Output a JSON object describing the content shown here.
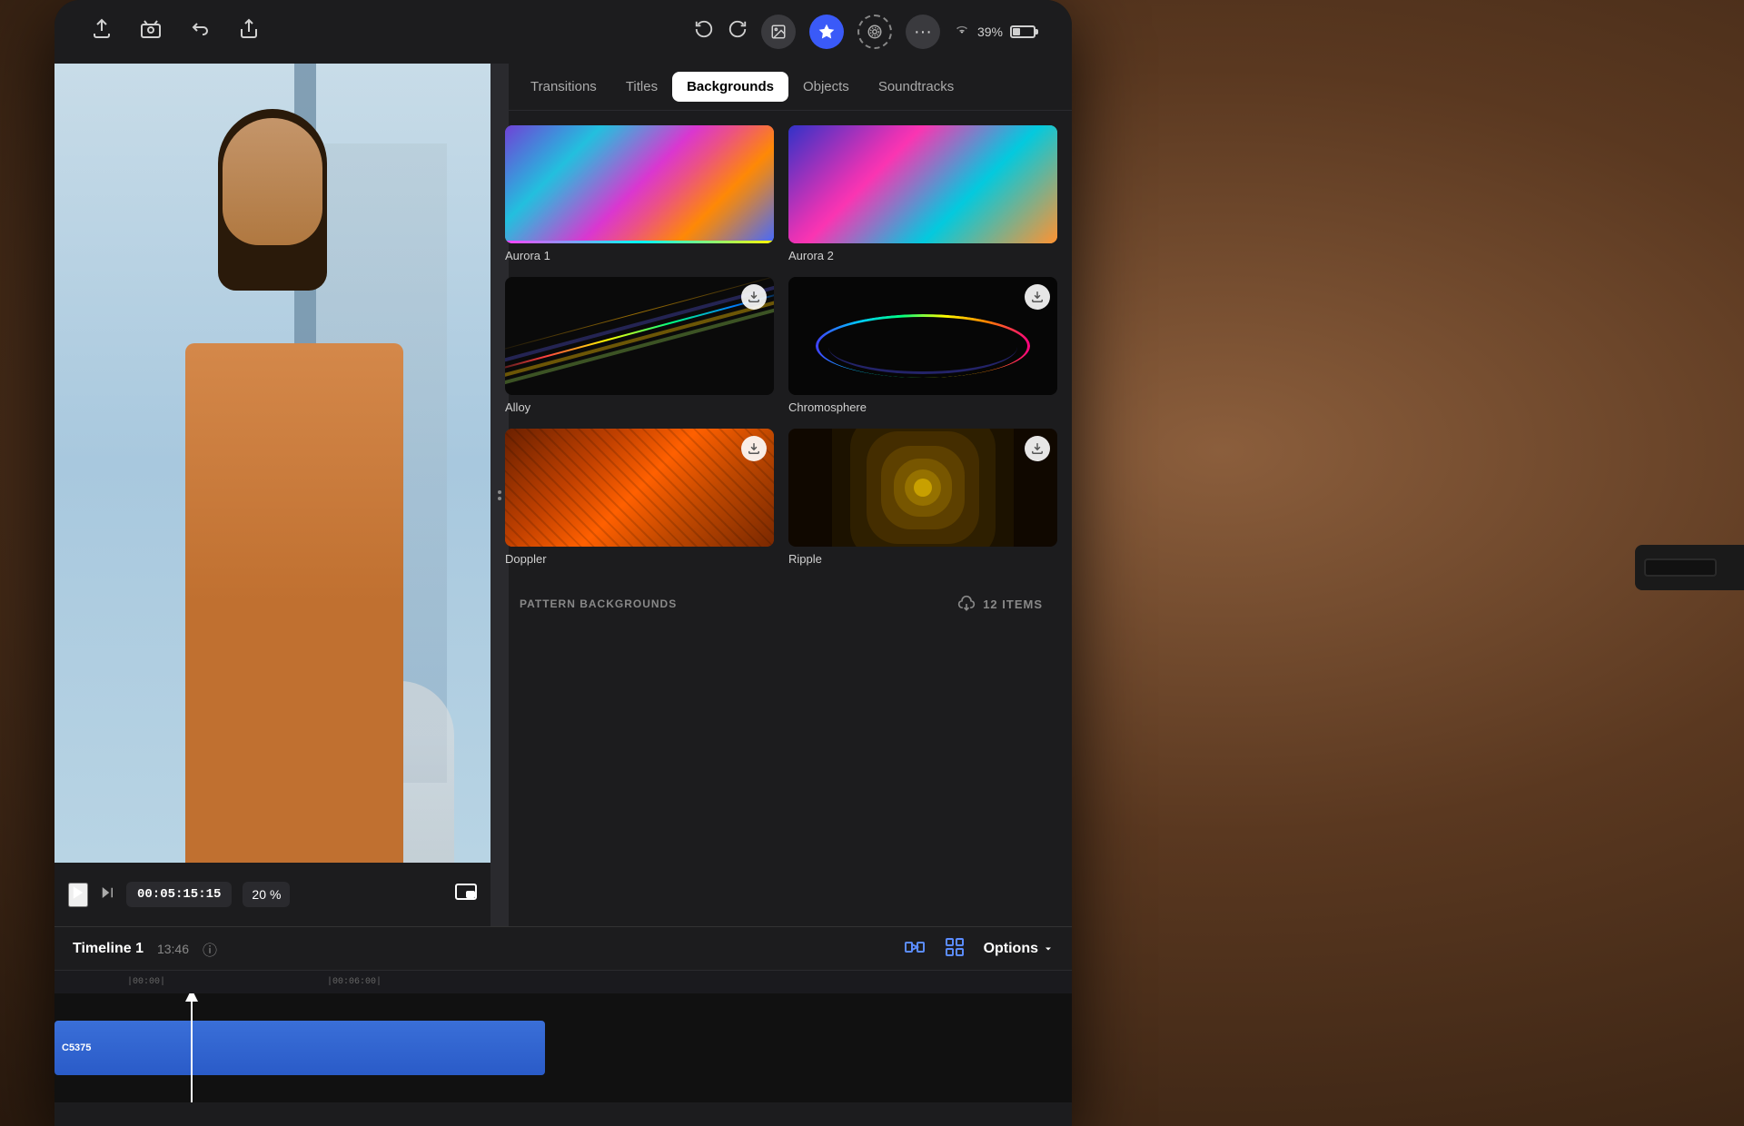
{
  "device": {
    "type": "iPad",
    "status": {
      "wifi": "WiFi",
      "battery_pct": "39%"
    }
  },
  "toolbar": {
    "export_label": "Export",
    "camera_label": "Camera",
    "undo_label": "Undo",
    "share_label": "Share",
    "undo_icon": "↩",
    "redo_icon": "↪",
    "media_icon": "🖼",
    "starred_icon": "⭐",
    "effects_icon": "⊙",
    "more_icon": "···"
  },
  "tabs": {
    "transitions": "Transitions",
    "titles": "Titles",
    "backgrounds": "Backgrounds",
    "objects": "Objects",
    "soundtracks": "Soundtracks",
    "active": "backgrounds"
  },
  "backgrounds_section": {
    "items": [
      {
        "id": "aurora1",
        "label": "Aurora 1",
        "thumb": "aurora1"
      },
      {
        "id": "aurora2",
        "label": "Aurora 2",
        "thumb": "aurora2"
      },
      {
        "id": "alloy",
        "label": "Alloy",
        "thumb": "alloy",
        "downloadable": true
      },
      {
        "id": "chromosphere",
        "label": "Chromosphere",
        "thumb": "chromosphere",
        "downloadable": true
      },
      {
        "id": "doppler",
        "label": "Doppler",
        "thumb": "doppler",
        "downloadable": true
      },
      {
        "id": "ripple",
        "label": "Ripple",
        "thumb": "ripple",
        "downloadable": true
      }
    ]
  },
  "pattern_backgrounds": {
    "label": "PATTERN BACKGROUNDS",
    "item_count": "12 Items"
  },
  "transport": {
    "timecode": "00:05:15:15",
    "zoom": "20",
    "zoom_unit": "%"
  },
  "timeline": {
    "title": "Timeline 1",
    "duration": "13:46",
    "clip_label": "C5375",
    "marker1": "|00:00|",
    "marker2": "|00:06:00|",
    "options_label": "Options"
  }
}
